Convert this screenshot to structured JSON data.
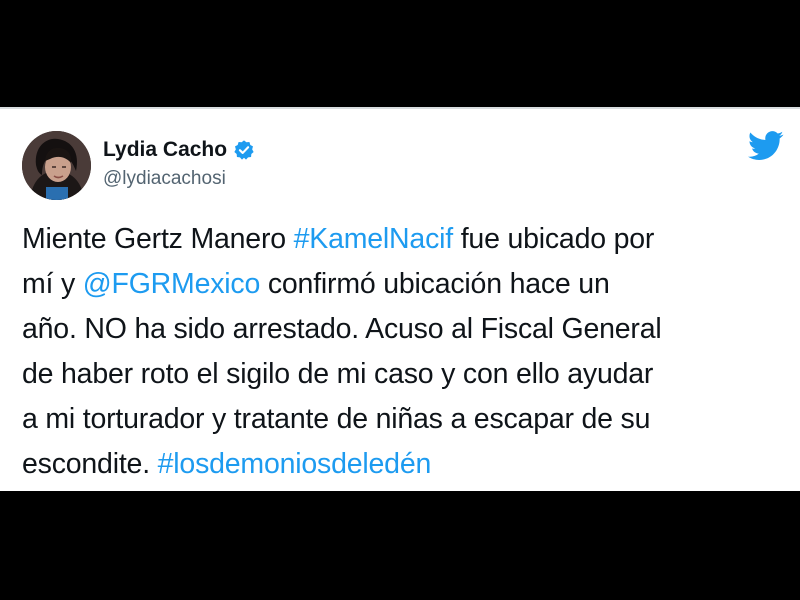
{
  "author": {
    "display_name": "Lydia Cacho",
    "handle": "@lydiacachosi",
    "verified": true,
    "avatar_icon": "profile-photo"
  },
  "brand": {
    "icon": "twitter-bird-icon",
    "color": "#1d9bf0"
  },
  "tweet": {
    "lines": [
      [
        {
          "text": "Miente Gertz Manero ",
          "type": "text"
        },
        {
          "text": "#KamelNacif",
          "type": "hashtag"
        },
        {
          "text": " fue ubicado por",
          "type": "text"
        }
      ],
      [
        {
          "text": "mí y  ",
          "type": "text"
        },
        {
          "text": "@FGRMexico",
          "type": "mention"
        },
        {
          "text": " confirmó ubicación hace un",
          "type": "text"
        }
      ],
      [
        {
          "text": "año. NO ha sido arrestado. Acuso al Fiscal General",
          "type": "text"
        }
      ],
      [
        {
          "text": "de haber roto el sigilo de mi caso y con ello ayudar",
          "type": "text"
        }
      ],
      [
        {
          "text": "a mi torturador y tratante de niñas a escapar de su",
          "type": "text"
        }
      ],
      [
        {
          "text": "escondite.  ",
          "type": "text"
        },
        {
          "text": "#losdemoniosdeledén",
          "type": "hashtag"
        }
      ]
    ]
  },
  "colors": {
    "text": "#0f1419",
    "secondary": "#536471",
    "link": "#1d9bf0",
    "background": "#ffffff",
    "letterbox": "#000000"
  }
}
